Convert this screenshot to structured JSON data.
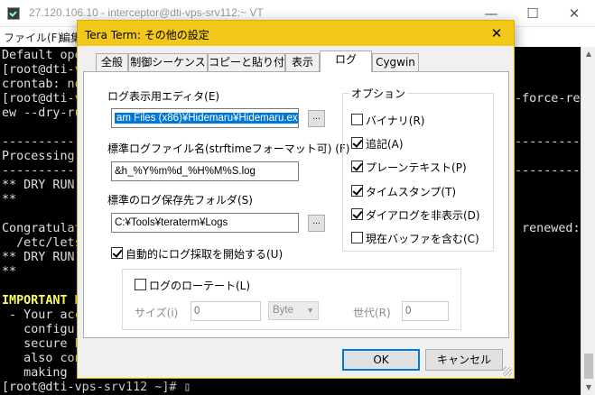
{
  "terminal": {
    "title": "27.120.106.10 - interceptor@dti-vps-srv112:~ VT",
    "menu": [
      "ファイル(F)",
      "編集"
    ],
    "controls": {
      "minimize": "—",
      "maximize": "☐",
      "close": "✕"
    },
    "lines": [
      {
        "text": "Default oper",
        "style": "normal"
      },
      {
        "text": "[root@dti-vp",
        "style": "normal"
      },
      {
        "text": "crontab: no",
        "style": "normal"
      },
      {
        "text": "[root@dti-vp",
        "style": "normal"
      },
      {
        "text": "ew --dry-run",
        "style": "normal"
      },
      {
        "text": "",
        "style": "normal"
      },
      {
        "text": "------------",
        "style": "normal"
      },
      {
        "text": "Processing /",
        "style": "normal"
      },
      {
        "text": "------------",
        "style": "normal"
      },
      {
        "text": "** DRY RUN: ",
        "style": "normal"
      },
      {
        "text": "**",
        "style": "normal"
      },
      {
        "text": "",
        "style": "normal"
      },
      {
        "text": "Congratulat",
        "style": "normal"
      },
      {
        "text": "  /etc/letse",
        "style": "normal"
      },
      {
        "text": "** DRY RUN: ",
        "style": "normal"
      },
      {
        "text": "**",
        "style": "normal"
      },
      {
        "text": "",
        "style": "normal"
      },
      {
        "text": "IMPORTANT NO",
        "style": "yellow"
      },
      {
        "text": " - Your acco",
        "style": "normal"
      },
      {
        "text": "   configura",
        "style": "normal"
      },
      {
        "text": "   secure ba",
        "style": "normal"
      },
      {
        "text": "   also cont",
        "style": "normal"
      },
      {
        "text": "   making re",
        "style": "normal"
      },
      {
        "text": "[root@dti-vps-srv112 ~]# ▯",
        "style": "normal"
      }
    ],
    "right_fragments": [
      {
        "text": "-force-ren",
        "row": 3
      },
      {
        "text": "------------",
        "row": 6
      },
      {
        "text": "------------",
        "row": 8
      },
      {
        "text": " renewed:",
        "row": 12
      }
    ]
  },
  "dialog": {
    "title": "Tera Term: その他の設定",
    "close": "✕",
    "tabs": [
      "全般",
      "制御シーケンス",
      "コピーと貼り付け",
      "表示",
      "ログ",
      "Cygwin"
    ],
    "active_tab": "ログ",
    "editor_label": "ログ表示用エディタ(E)",
    "editor_value": "am Files (x86)¥Hidemaru¥Hidemaru.exe",
    "browse": "...",
    "filename_label": "標準ログファイル名(strftimeフォーマット可) (F)",
    "filename_value": "&h_%Y%m%d_%H%M%S.log",
    "folder_label": "標準のログ保存先フォルダ(S)",
    "folder_value": "C:¥Tools¥teraterm¥Logs",
    "autostart_label": "自動的にログ採取を開始する(U)",
    "autostart_checked": true,
    "options_legend": "オプション",
    "options": [
      {
        "label": "バイナリ(R)",
        "checked": false
      },
      {
        "label": "追記(A)",
        "checked": true
      },
      {
        "label": "プレーンテキスト(P)",
        "checked": true
      },
      {
        "label": "タイムスタンプ(T)",
        "checked": true
      },
      {
        "label": "ダイアログを非表示(D)",
        "checked": true
      },
      {
        "label": "現在バッファを含む(C)",
        "checked": false
      }
    ],
    "rotate": {
      "label": "ログのローテート(L)",
      "checked": false,
      "size_label": "サイズ(i)",
      "size_value": "0",
      "unit": "Byte",
      "generation_label": "世代(R)",
      "generation_value": "0"
    },
    "ok": "OK",
    "cancel": "キャンセル"
  },
  "colors": {
    "dialog_title_bg": "#f2c81a",
    "selection": "#0078d7",
    "terminal_bg": "#000000",
    "important_text": "#ffff55"
  }
}
